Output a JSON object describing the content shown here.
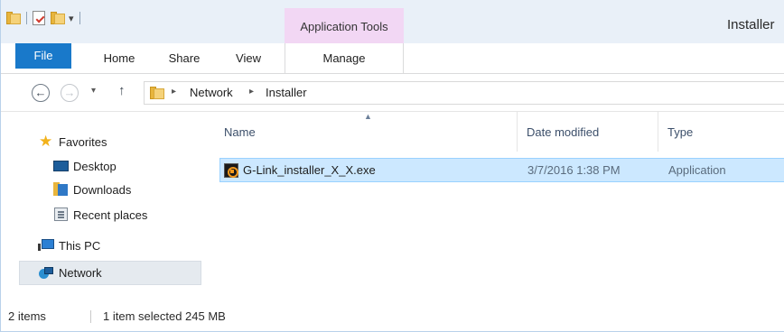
{
  "window": {
    "title": "Installer"
  },
  "quick_access": {
    "icons": [
      "folder-icon",
      "properties-icon",
      "new-folder-icon",
      "customize-dropdown-icon"
    ],
    "dropdown_glyph": "▾"
  },
  "ribbon": {
    "context_group": "Application Tools",
    "tabs": [
      {
        "label": "File"
      },
      {
        "label": "Home"
      },
      {
        "label": "Share"
      },
      {
        "label": "View"
      },
      {
        "label": "Manage"
      }
    ],
    "file_tab_color": "#1979ca",
    "context_color": "#f2d7f4"
  },
  "address_bar": {
    "back_glyph": "←",
    "forward_glyph": "→",
    "recent_glyph": "▾",
    "up_glyph": "↑",
    "separator_glyph": "▸",
    "breadcrumbs": [
      "Network",
      "Installer"
    ]
  },
  "nav_pane": {
    "items": [
      {
        "label": "Favorites",
        "icon": "star-icon"
      },
      {
        "label": "Desktop",
        "icon": "desktop-icon"
      },
      {
        "label": "Downloads",
        "icon": "downloads-icon"
      },
      {
        "label": "Recent places",
        "icon": "recent-places-icon"
      },
      {
        "label": "This PC",
        "icon": "this-pc-icon"
      },
      {
        "label": "Network",
        "icon": "network-icon",
        "selected": true
      }
    ],
    "star_glyph": "★"
  },
  "file_list": {
    "columns": [
      "Name",
      "Date modified",
      "Type"
    ],
    "sort_glyph": "▲",
    "rows": [
      {
        "name": "G-Link_installer_X_X.exe",
        "date": "3/7/2016 1:38 PM",
        "type": "Application",
        "icon": "exe-icon",
        "selected": true
      }
    ],
    "selection_color": "#cce8ff"
  },
  "status_bar": {
    "item_count": "2 items",
    "selection": "1 item selected  245 MB"
  }
}
